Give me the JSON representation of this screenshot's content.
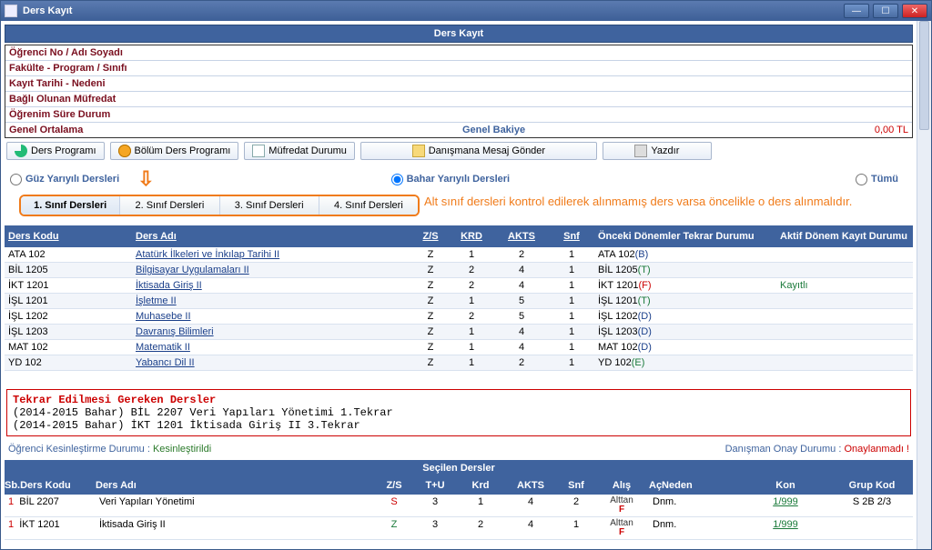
{
  "window": {
    "title": "Ders Kayıt"
  },
  "panel_title": "Ders Kayıt",
  "info_labels": {
    "ogrenci": "Öğrenci No / Adı Soyadı",
    "fakulte": "Fakülte - Program / Sınıfı",
    "kayit": "Kayıt Tarihi - Nedeni",
    "mufredat": "Bağlı Olunan Müfredat",
    "ogrenim": "Öğrenim Süre Durum",
    "genel": "Genel Ortalama",
    "bakiye_label": "Genel Bakiye",
    "bakiye_value": "0,00 TL"
  },
  "toolbar": {
    "ders_programi": "Ders Programı",
    "bolum_ders": "Bölüm Ders Programı",
    "mufredat_durumu": "Müfredat Durumu",
    "mesaj": "Danışmana Mesaj Gönder",
    "yazdir": "Yazdır"
  },
  "semester": {
    "guz": "Güz Yarıyılı Dersleri",
    "bahar": "Bahar Yarıyılı Dersleri",
    "tumu": "Tümü"
  },
  "class_tabs": [
    "1. Sınıf Dersleri",
    "2. Sınıf Dersleri",
    "3. Sınıf Dersleri",
    "4. Sınıf Dersleri"
  ],
  "annotation": "Alt sınıf dersleri kontrol edilerek alınmamış ders varsa öncelikle o ders alınmalıdır.",
  "grid_headers": {
    "ders_kodu": "Ders Kodu",
    "ders_adi": "Ders Adı",
    "zs": "Z/S",
    "krd": "KRD",
    "akts": "AKTS",
    "snf": "Snf",
    "onceki": "Önceki Dönemler Tekrar Durumu",
    "aktif": "Aktif Dönem Kayıt Durumu"
  },
  "courses": [
    {
      "code": "ATA 102",
      "name": "Atatürk İlkeleri ve İnkılap Tarihi II",
      "zs": "Z",
      "krd": "1",
      "akts": "2",
      "snf": "1",
      "prev": "ATA 102",
      "ptag": "(B)",
      "akt": ""
    },
    {
      "code": "BİL 1205",
      "name": "Bilgisayar Uygulamaları II",
      "zs": "Z",
      "krd": "2",
      "akts": "4",
      "snf": "1",
      "prev": "BİL 1205",
      "ptag": "(T)",
      "akt": ""
    },
    {
      "code": "İKT 1201",
      "name": "İktisada Giriş II",
      "zs": "Z",
      "krd": "2",
      "akts": "4",
      "snf": "1",
      "prev": "İKT 1201",
      "ptag": "(F)",
      "akt": "Kayıtlı"
    },
    {
      "code": "İŞL 1201",
      "name": "İşletme II",
      "zs": "Z",
      "krd": "1",
      "akts": "5",
      "snf": "1",
      "prev": "İŞL 1201",
      "ptag": "(T)",
      "akt": ""
    },
    {
      "code": "İŞL 1202",
      "name": "Muhasebe II",
      "zs": "Z",
      "krd": "2",
      "akts": "5",
      "snf": "1",
      "prev": "İŞL 1202",
      "ptag": "(D)",
      "akt": ""
    },
    {
      "code": "İŞL 1203",
      "name": "Davranış Bilimleri",
      "zs": "Z",
      "krd": "1",
      "akts": "4",
      "snf": "1",
      "prev": "İŞL 1203",
      "ptag": "(D)",
      "akt": ""
    },
    {
      "code": "MAT 102",
      "name": "Matematik II",
      "zs": "Z",
      "krd": "1",
      "akts": "4",
      "snf": "1",
      "prev": "MAT 102",
      "ptag": "(D)",
      "akt": ""
    },
    {
      "code": "YD 102",
      "name": "Yabancı Dil II",
      "zs": "Z",
      "krd": "1",
      "akts": "2",
      "snf": "1",
      "prev": "YD 102",
      "ptag": "(E)",
      "akt": ""
    }
  ],
  "repeat": {
    "title": "Tekrar Edilmesi Gereken Dersler",
    "line1": "(2014-2015 Bahar) BİL 2207 Veri Yapıları Yönetimi 1.Tekrar",
    "line2": "(2014-2015 Bahar) İKT 1201 İktisada Giriş II 3.Tekrar"
  },
  "status": {
    "kesin_label": "Öğrenci Kesinleştirme Durumu : ",
    "kesin_value": "Kesinleştirildi",
    "onay_label": "Danışman Onay Durumu : ",
    "onay_value": "Onaylanmadı !"
  },
  "selected_title": "Seçilen Dersler",
  "sel_headers": {
    "sb": "Sb.Ders Kodu",
    "name": "Ders Adı",
    "zs": "Z/S",
    "tu": "T+U",
    "krd": "Krd",
    "akts": "AKTS",
    "snf": "Snf",
    "alis": "Alış",
    "acn": "AçNeden",
    "kon": "Kon",
    "grp": "Grup Kod"
  },
  "selected": [
    {
      "idx": "1",
      "sb": "BİL 2207",
      "name": "Veri Yapıları Yönetimi",
      "zs": "S",
      "tu": "3",
      "krd": "1",
      "akts": "4",
      "snf": "2",
      "alis": "Alttan F",
      "acn": "Dnm.",
      "kon": "1/999",
      "grp": "S 2B 2/3"
    },
    {
      "idx": "1",
      "sb": "İKT 1201",
      "name": "İktisada Giriş II",
      "zs": "Z",
      "tu": "3",
      "krd": "2",
      "akts": "4",
      "snf": "1",
      "alis": "Alttan F",
      "acn": "Dnm.",
      "kon": "1/999",
      "grp": ""
    }
  ]
}
